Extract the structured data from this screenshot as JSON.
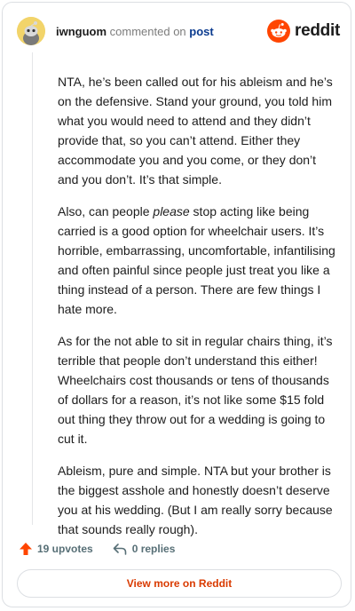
{
  "header": {
    "username": "iwnguom",
    "action_text": "commented on",
    "post_link": "post",
    "brand": "reddit"
  },
  "comment": {
    "p1": "NTA, he’s been called out for his ableism and he’s on the defensive. Stand your ground, you told him what you would need to attend and they didn’t provide that, so you can’t attend. Either they accommodate you and you come, or they don’t and you don’t. It’s that simple.",
    "p2_a": "Also, can people ",
    "p2_em": "please",
    "p2_b": " stop acting like being carried is a good option for wheelchair users. It’s horrible, embarrassing, uncomfortable, infantilising and often painful since people just treat you like a thing instead of a person. There are few things I hate more.",
    "p3": "As for the not able to sit in regular chairs thing, it’s terrible that people don’t understand this either! Wheelchairs cost thousands or tens of thousands of dollars for a reason, it’s not like some $15 fold out thing they throw out for a wedding is going to cut it.",
    "p4": "Ableism, pure and simple. NTA but your brother is the biggest asshole and honestly doesn’t deserve you at his wedding. (But I am really sorry because that sounds really rough)."
  },
  "actions": {
    "upvotes": "19 upvotes",
    "replies": "0 replies"
  },
  "footer": {
    "view_more": "View more on Reddit"
  },
  "colors": {
    "brand_orange": "#ff4500",
    "link_blue": "#0b3b8f",
    "cta_orange": "#d93a00"
  }
}
